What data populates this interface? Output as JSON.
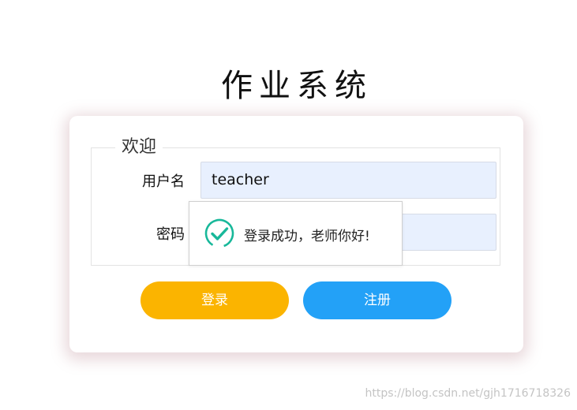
{
  "app": {
    "title": "作业系统"
  },
  "form": {
    "legend": "欢迎",
    "username_label": "用户名",
    "username_value": "teacher",
    "password_label": "密码",
    "password_value": ""
  },
  "buttons": {
    "login_label": "登录",
    "register_label": "注册"
  },
  "toast": {
    "icon": "check-circle-icon",
    "message": "登录成功，老师你好!"
  },
  "watermark": {
    "text": "https://blog.csdn.net/gjh1716718326"
  },
  "colors": {
    "login_button": "#fbb400",
    "register_button": "#23a1f7",
    "input_background": "#e8f0fe",
    "success_icon": "#18b89a"
  }
}
